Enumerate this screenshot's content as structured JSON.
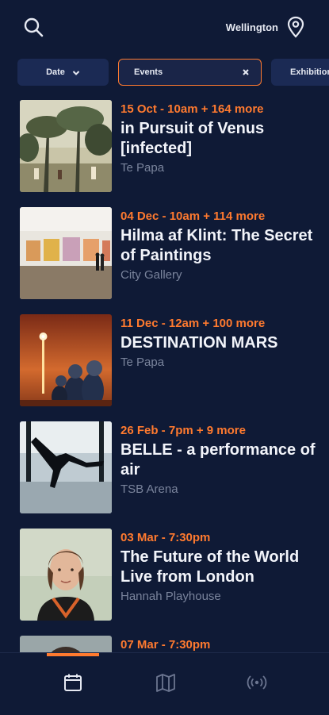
{
  "header": {
    "search_icon": "search-icon",
    "location_label": "Wellington",
    "location_icon": "map-pin-icon"
  },
  "filters": {
    "date_label": "Date",
    "events_label": "Events",
    "exhibitions_label": "Exhibitions"
  },
  "events": [
    {
      "when": "15 Oct - 10am + 164 more",
      "title": "in Pursuit of Venus [infected]",
      "venue": "Te Papa"
    },
    {
      "when": "04 Dec - 10am + 114 more",
      "title": "Hilma af Klint: The Secret of Paintings",
      "venue": "City Gallery"
    },
    {
      "when": "11 Dec - 12am + 100 more",
      "title": "DESTINATION MARS",
      "venue": "Te Papa"
    },
    {
      "when": "26 Feb - 7pm + 9 more",
      "title": "BELLE - a performance of air",
      "venue": "TSB Arena"
    },
    {
      "when": "03 Mar - 7:30pm",
      "title": "The Future of the World Live from London",
      "venue": "Hannah Playhouse"
    },
    {
      "when": "07 Mar - 7:30pm",
      "title": "",
      "venue": ""
    }
  ],
  "tabs": [
    {
      "icon": "calendar-icon",
      "active": true
    },
    {
      "icon": "map-icon",
      "active": false
    },
    {
      "icon": "broadcast-icon",
      "active": false
    }
  ],
  "colors": {
    "background": "#0f1a36",
    "accent": "#ff7a2f",
    "chip": "#1b2a54",
    "muted_text": "#7a849c"
  }
}
